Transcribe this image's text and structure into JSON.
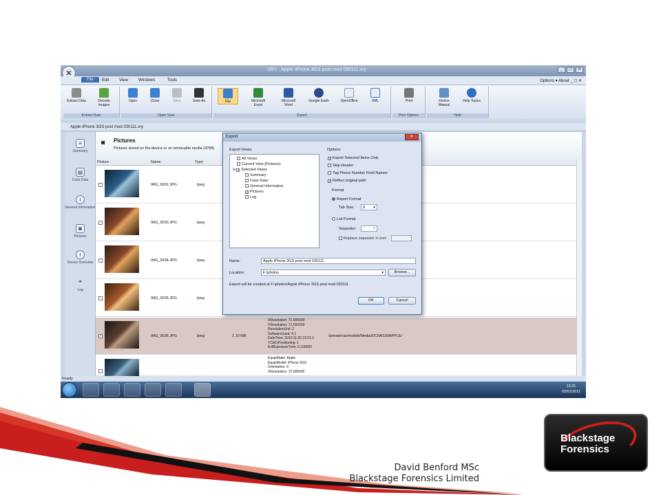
{
  "app": {
    "window_title": "XRY - Apple iPhone 3GS post mod 030111.xry",
    "menu": [
      "File",
      "Edit",
      "View",
      "Windows",
      "Tools"
    ],
    "menu_right": "Options ▾  About  _ ◻ ✕"
  },
  "ribbon": {
    "groups": [
      {
        "label": "Extract Data",
        "buttons": [
          "Extract Data",
          "Decode Images"
        ]
      },
      {
        "label": "Open Save",
        "buttons": [
          "Open",
          "Close",
          "Save",
          "Save As"
        ]
      },
      {
        "label": "Export",
        "buttons": [
          "File",
          "Microsoft Excel",
          "Microsoft Word",
          "Google Earth",
          "OpenOffice",
          "XML"
        ]
      },
      {
        "label": "Print Options",
        "buttons": [
          "Print"
        ]
      },
      {
        "label": "Help",
        "buttons": [
          "Device Manual",
          "Help Topics"
        ]
      }
    ]
  },
  "document": {
    "tab_title": "Apple iPhone 3GS post mod 030111.xry",
    "section_title": "Pictures",
    "section_subtitle": "Pictures stored on the device or on removable media (4788)"
  },
  "nav": [
    "Summary",
    "Case Data",
    "General Information",
    "Pictures",
    "Device Overview",
    "Log"
  ],
  "table": {
    "headers": [
      "Picture",
      "Name",
      "Type"
    ],
    "rows": [
      {
        "name": "IMG_0032.JPG",
        "type": "Jpeg",
        "size": "",
        "meta": "",
        "path": "",
        "checked": false,
        "selected": false
      },
      {
        "name": "IMG_0033.JPG",
        "type": "Jpeg",
        "size": "",
        "meta": "",
        "path": "",
        "checked": false,
        "selected": false
      },
      {
        "name": "IMG_0034.JPG",
        "type": "Jpeg",
        "size": "",
        "meta": "",
        "path": "",
        "checked": false,
        "selected": false
      },
      {
        "name": "IMG_0035.JPG",
        "type": "Jpeg",
        "size": "",
        "meta": "",
        "path": "",
        "checked": false,
        "selected": false
      },
      {
        "name": "IMG_0036.JPG",
        "type": "Jpeg",
        "size": "1.10 MB",
        "meta": "XResolution: 72.000000\nYResolution: 72.000000\nResolutionUnit: 2\nSoftwareUsed: 4.1\nDateTime: 2010:11:25 19:21:2\nYCbCrPositioning: 1\nExifExposureTime: 0.100000",
        "path": "/private/var/mobile/Media/DCIM/100APPLE/",
        "checked": true,
        "selected": true
      },
      {
        "name": "",
        "type": "",
        "size": "",
        "meta": "EquipMake: Apple\nEquipModel: iPhone 3GS\nOrientation: 6\nXResolution: 72.000000",
        "path": "",
        "checked": false,
        "selected": false
      }
    ]
  },
  "status": "Ready",
  "clock": {
    "time": "13:31",
    "date": "03/01/2011"
  },
  "dialog": {
    "title": "Export",
    "close": "✕",
    "export_views_label": "Export Views:",
    "tree": [
      "All Views",
      "Current View (Pictures)",
      "Selected Views",
      "Summary",
      "Case Data",
      "General Information",
      "Pictures",
      "Log"
    ],
    "options_label": "Options:",
    "options": [
      {
        "label": "Export Selected Items Only",
        "checked": true
      },
      {
        "label": "Skip Header",
        "checked": false
      },
      {
        "label": "Tag Phone Number Field Names",
        "checked": false
      },
      {
        "label": "Reflect original path",
        "checked": true
      }
    ],
    "format_label": "Format",
    "report_format": "Report Format",
    "tab_size_label": "Tab Size:",
    "tab_size_value": "8",
    "list_format": "List Format",
    "separator_label": "Separator:",
    "separator_value": ";",
    "replace_label": "Replace separator in text:",
    "name_label": "Name:",
    "name_value": "Apple iPhone 3GS post mod 030111",
    "location_label": "Location:",
    "location_value": "F:\\photos",
    "browse": "Browse...",
    "created_note": "Export will be created at F:\\photos\\Apple iPhone 3GS post mod 030111",
    "ok": "OK",
    "cancel": "Cancel"
  },
  "credit": {
    "line1": "David Benford MSc",
    "line2": "Blackstage Forensics Limited"
  },
  "logo": {
    "line1": "Blackstage",
    "line2": "Forensics"
  }
}
